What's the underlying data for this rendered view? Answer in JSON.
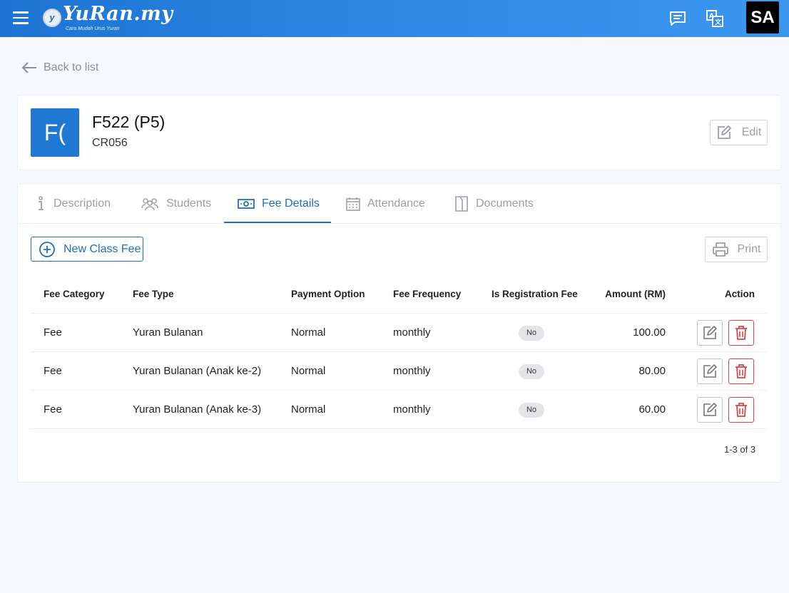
{
  "header": {
    "logo_text": "YuRan.my",
    "logo_tagline": "Cara Mudah Urus Yuran",
    "avatar_initials": "SA"
  },
  "back_link": "Back to list",
  "class": {
    "avatar_text": "F(",
    "title": "F522 (P5)",
    "code": "CR056",
    "edit_label": "Edit"
  },
  "tabs": [
    {
      "label": "Description",
      "icon": "info-icon"
    },
    {
      "label": "Students",
      "icon": "people-icon"
    },
    {
      "label": "Fee Details",
      "icon": "money-icon",
      "active": true
    },
    {
      "label": "Attendance",
      "icon": "calendar-icon"
    },
    {
      "label": "Documents",
      "icon": "document-icon"
    }
  ],
  "toolbar": {
    "new_label": "New Class Fee",
    "print_label": "Print"
  },
  "table": {
    "columns": [
      "Fee Category",
      "Fee Type",
      "Payment Option",
      "Fee Frequency",
      "Is Registration Fee",
      "Amount (RM)",
      "Action"
    ],
    "rows": [
      {
        "category": "Fee",
        "type": "Yuran Bulanan",
        "payment": "Normal",
        "frequency": "monthly",
        "registration": "No",
        "amount": "100.00"
      },
      {
        "category": "Fee",
        "type": "Yuran Bulanan (Anak ke-2)",
        "payment": "Normal",
        "frequency": "monthly",
        "registration": "No",
        "amount": "80.00"
      },
      {
        "category": "Fee",
        "type": "Yuran Bulanan (Anak ke-3)",
        "payment": "Normal",
        "frequency": "monthly",
        "registration": "No",
        "amount": "60.00"
      }
    ],
    "pagination": "1-3 of 3"
  },
  "colors": {
    "accent": "#1f6fc4",
    "header": "#2f8ae6",
    "danger": "#e04343"
  }
}
